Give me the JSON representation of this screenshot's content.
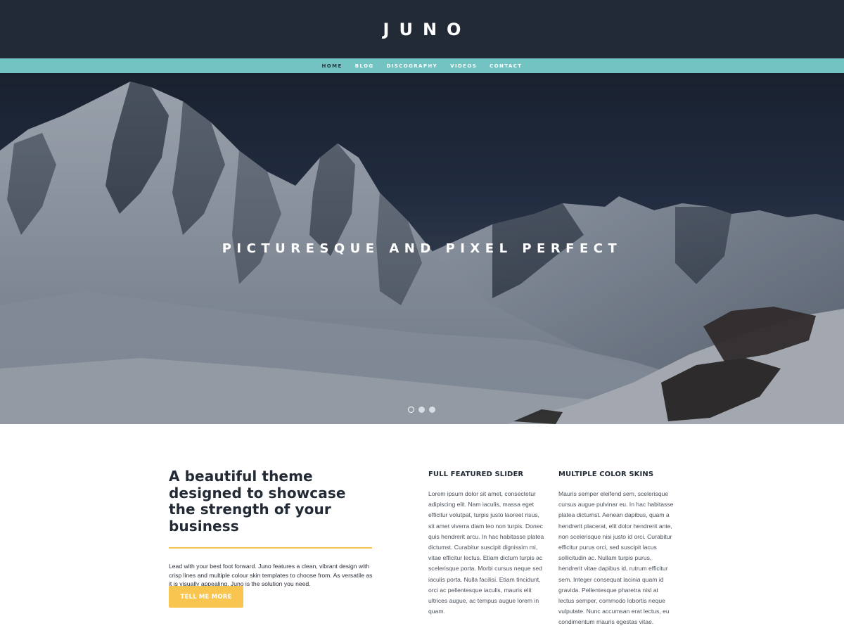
{
  "header": {
    "logo": "JUNO"
  },
  "nav": {
    "items": [
      "HOME",
      "BLOG",
      "DISCOGRAPHY",
      "VIDEOS",
      "CONTACT"
    ],
    "active": "HOME"
  },
  "hero": {
    "title": "PICTURESQUE AND PIXEL PERFECT",
    "slides_count": 3,
    "active_slide": 1
  },
  "intro": {
    "heading": "A beautiful theme designed to showcase the strength of your business",
    "text": "Lead with your best foot forward. Juno features a clean, vibrant design with crisp lines and multiple colour skin templates to choose from. As versatile as it is visually appealing, Juno is the solution you need.",
    "button_label": "TELL ME MORE"
  },
  "features": [
    {
      "heading": "FULL FEATURED SLIDER",
      "text": "Lorem ipsum dolor sit amet, consectetur adipiscing elit. Nam iaculis, massa eget efficitur volutpat, turpis justo laoreet risus, sit amet viverra diam leo non turpis. Donec quis hendrerit arcu. In hac habitasse platea dictumst. Curabitur suscipit dignissim mi, vitae efficitur lectus. Etiam dictum turpis ac scelerisque porta. Morbi cursus neque sed iaculis porta. Nulla facilisi. Etiam tincidunt, orci ac pellentesque iaculis, mauris elit ultrices augue, ac tempus augue lorem in quam."
    },
    {
      "heading": "MULTIPLE COLOR SKINS",
      "text": "Mauris semper eleifend sem, scelerisque cursus augue pulvinar eu. In hac habitasse platea dictumst. Aenean dapibus, quam a hendrerit placerat, elit dolor hendrerit ante, non scelerisque nisi justo id orci. Curabitur efficitur purus orci, sed suscipit lacus sollicitudin ac. Nullam turpis purus, hendrerit vitae dapibus id, rutrum efficitur sem. Integer consequat lacinia quam id gravida. Pellentesque pharetra nisl at lectus semper, commodo lobortis neque vulputate. Nunc accumsan erat lectus, eu condimentum mauris egestas vitae."
    }
  ],
  "colors": {
    "header_bg": "#222a35",
    "nav_bg": "#72c3c2",
    "accent": "#f9c551"
  }
}
